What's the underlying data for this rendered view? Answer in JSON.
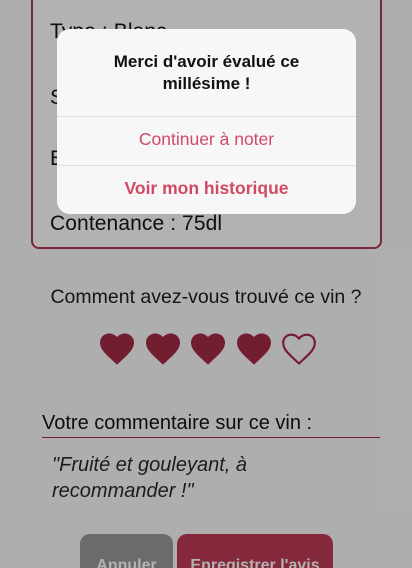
{
  "wine_info": {
    "type_line": "Type : Blanc",
    "line2": "S",
    "line3": "E",
    "capacity_line": "Contenance : 75dl"
  },
  "rating": {
    "question": "Comment avez-vous trouvé ce vin ?",
    "value": 4,
    "max": 5,
    "heart_color": "#a52a45",
    "hearts": [
      "heart-filled-icon",
      "heart-filled-icon",
      "heart-filled-icon",
      "heart-filled-icon",
      "heart-outline-icon"
    ]
  },
  "comment": {
    "label": "Votre commentaire sur ce vin :",
    "text": "\"Fruité et gouleyant, à recommander !\""
  },
  "buttons": {
    "cancel": "Annuler",
    "save": "Enregistrer l'avis"
  },
  "dialog": {
    "title": "Merci d'avoir évalué ce millésime !",
    "continue_label": "Continuer à noter",
    "history_label": "Voir mon historique",
    "accent_color": "#d04a66"
  }
}
